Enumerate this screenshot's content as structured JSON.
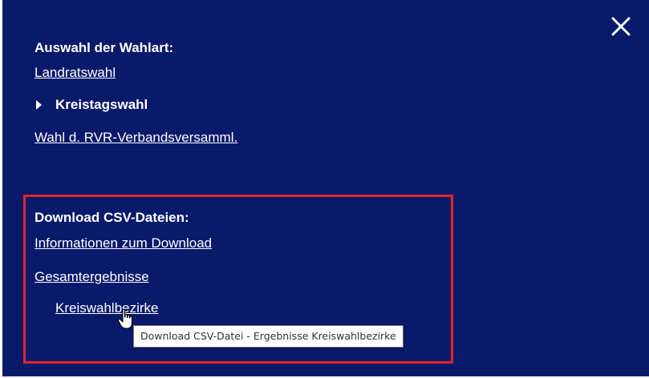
{
  "panel": {
    "background": "#0a1a6b",
    "close_icon": "close-icon"
  },
  "election_type": {
    "heading": "Auswahl der Wahlart:",
    "items": [
      {
        "label": "Landratswahl",
        "current": false
      },
      {
        "label": "Kreistagswahl",
        "current": true
      },
      {
        "label": "Wahl d. RVR-Verbandsversamml.",
        "current": false
      }
    ]
  },
  "download": {
    "heading": "Download CSV-Dateien:",
    "highlight_color": "#e8232b",
    "items": [
      {
        "label": "Informationen zum Download"
      },
      {
        "label": "Gesamtergebnisse"
      },
      {
        "label": "Kreiswahlbezirke"
      }
    ]
  },
  "tooltip": {
    "text": "Download CSV-Datei - Ergebnisse Kreiswahlbezirke"
  }
}
